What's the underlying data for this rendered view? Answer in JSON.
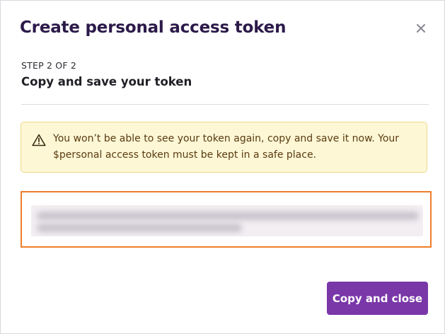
{
  "dialog": {
    "title": "Create personal access token",
    "close_icon": "close-icon",
    "step_label": "STEP 2 OF 2",
    "subtitle": "Copy and save your token"
  },
  "warning": {
    "icon": "warning-triangle-icon",
    "text": "You won’t be able to see your token again, copy and save it now. Your $personal access token must be kept in a safe place."
  },
  "token": {
    "value_obscured": true
  },
  "actions": {
    "primary_label": "Copy and close"
  },
  "colors": {
    "title": "#2c1a4a",
    "primary_button": "#7a37a8",
    "warning_bg": "#fdf7d6",
    "warning_border": "#ecd98a",
    "highlight_border": "#ef7d2b"
  }
}
